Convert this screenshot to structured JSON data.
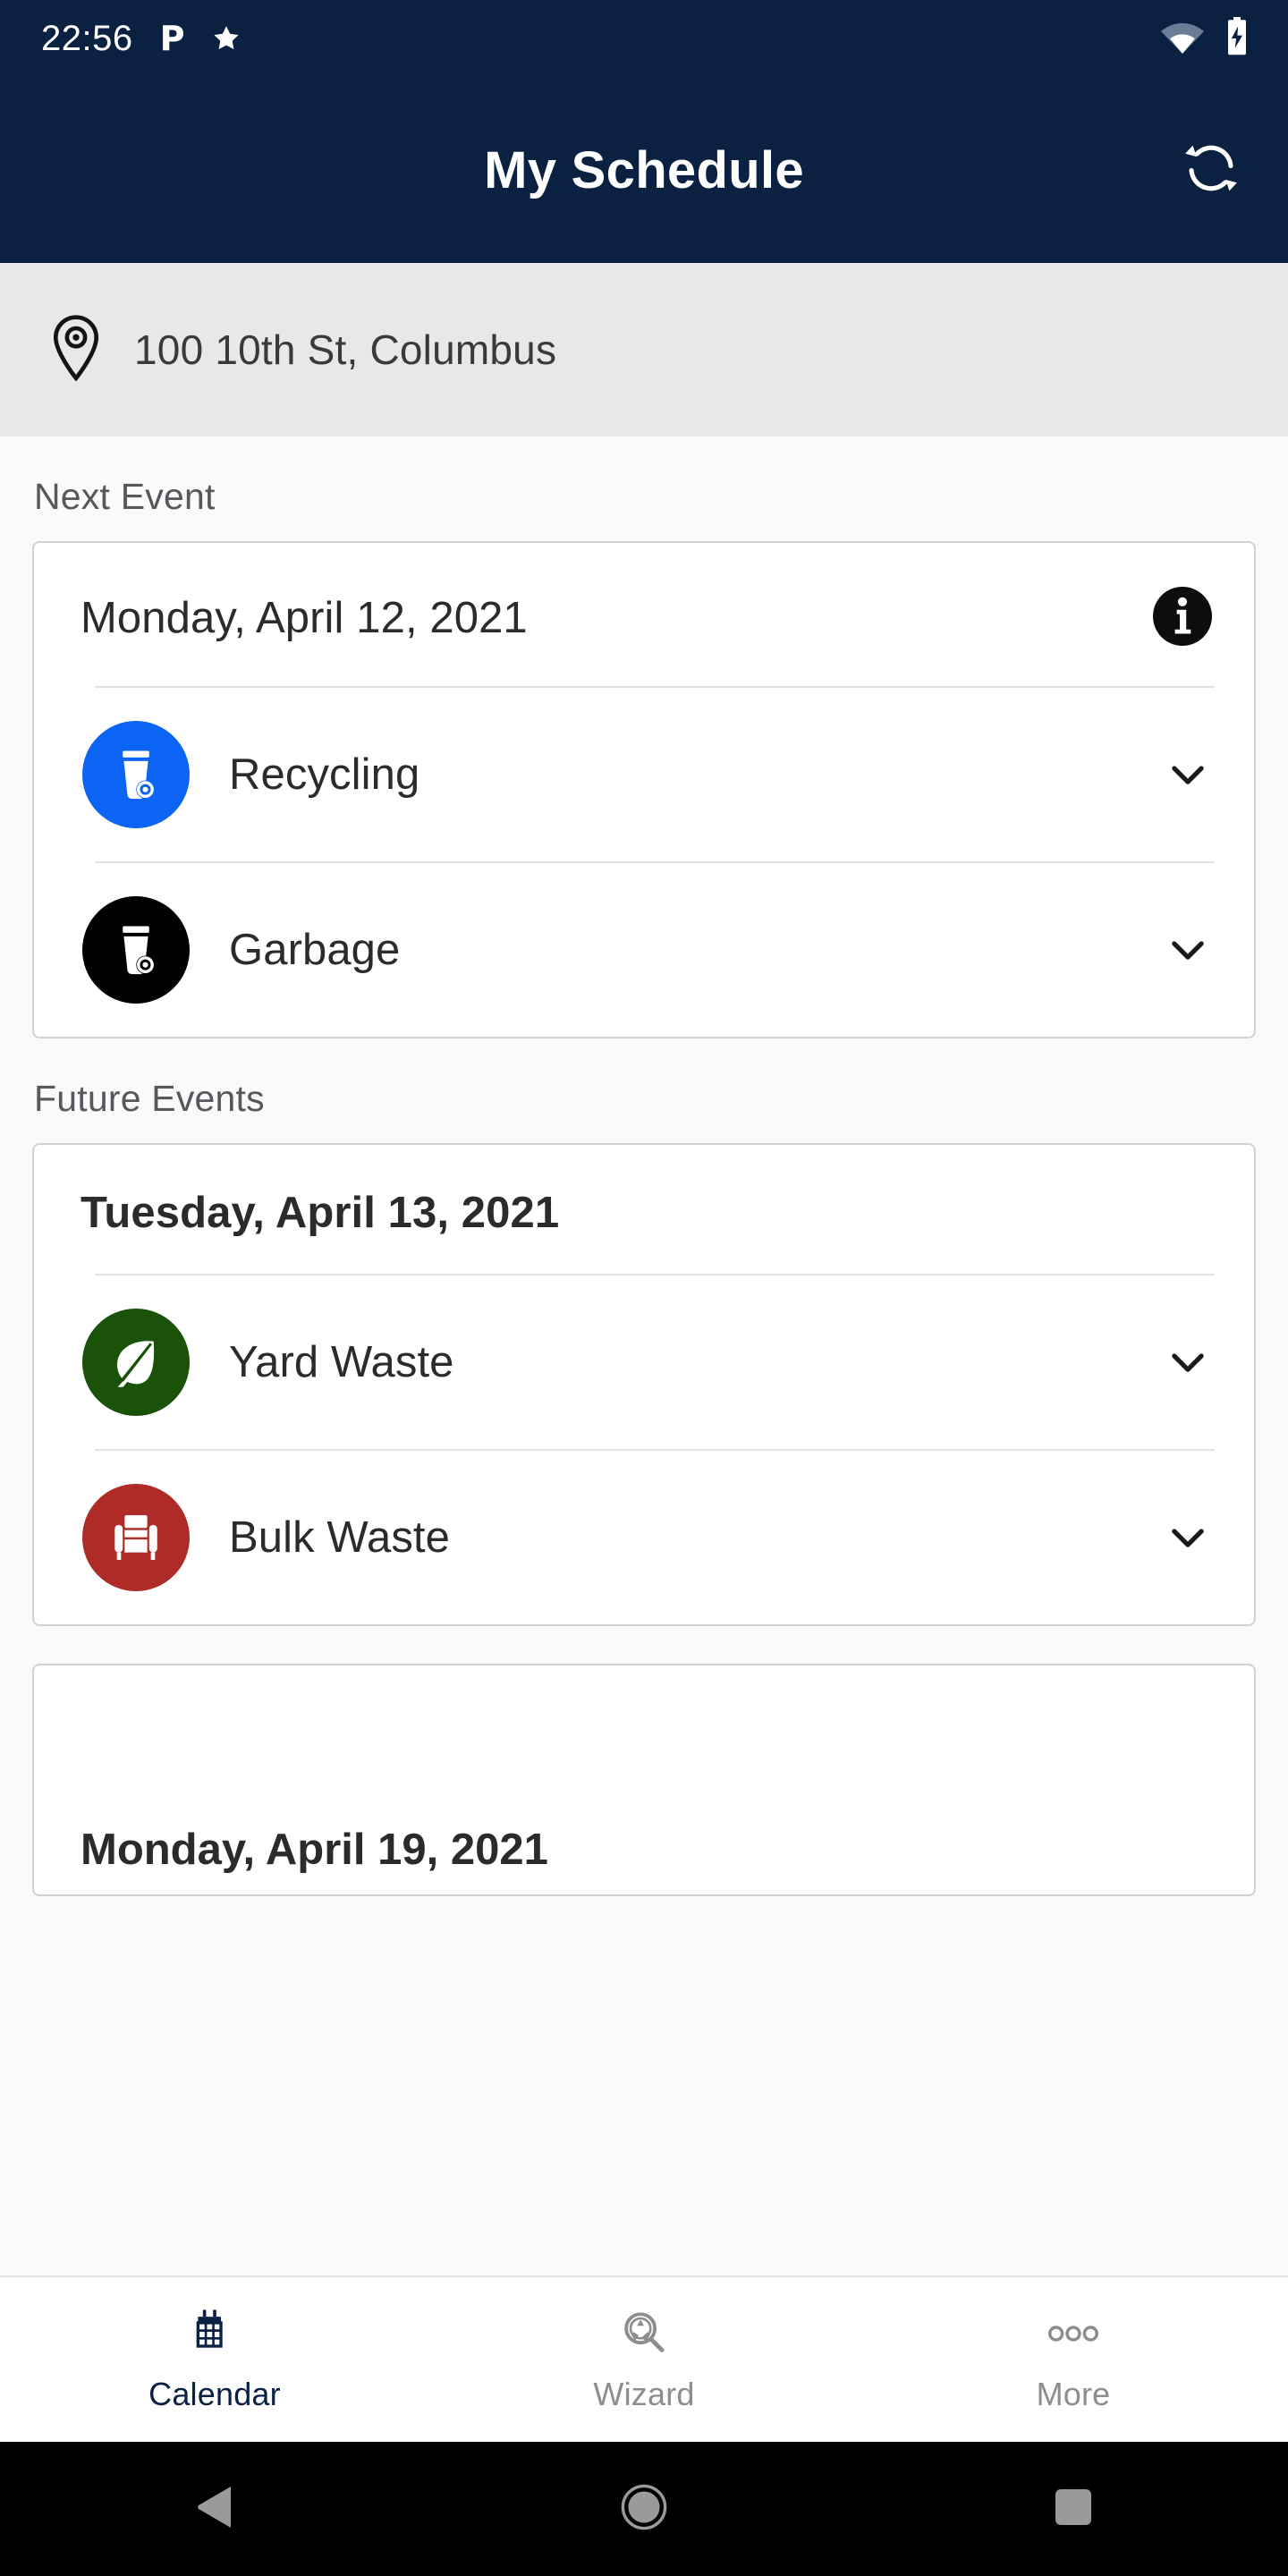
{
  "status_bar": {
    "time": "22:56",
    "left_icons": [
      "parking-p-icon",
      "star-icon"
    ],
    "right_icons": [
      "wifi-icon",
      "battery-charging-icon"
    ],
    "background_color": "#0b2142"
  },
  "app_bar": {
    "title": "My Schedule",
    "refresh_icon": "refresh-icon",
    "background_color": "#0b2142"
  },
  "address_bar": {
    "icon": "location-pin-icon",
    "address": "100 10th St, Columbus",
    "background_color": "#e8e8e8"
  },
  "sections": {
    "next_event_label": "Next Event",
    "future_events_label": "Future Events"
  },
  "next_event_card": {
    "date": "Monday, April 12, 2021",
    "info_icon": "info-circle-icon",
    "events": [
      {
        "name": "Recycling",
        "icon": "recycling-bin-icon",
        "color": "#0b64f4",
        "chevron": "chevron-down-icon"
      },
      {
        "name": "Garbage",
        "icon": "garbage-bin-icon",
        "color": "#000000",
        "chevron": "chevron-down-icon"
      }
    ]
  },
  "future_event_card": {
    "date": "Tuesday, April 13, 2021",
    "events": [
      {
        "name": "Yard Waste",
        "icon": "leaf-icon",
        "color": "#1a5209",
        "chevron": "chevron-down-icon"
      },
      {
        "name": "Bulk Waste",
        "icon": "armchair-icon",
        "color": "#ae2b28",
        "chevron": "chevron-down-icon"
      }
    ]
  },
  "peek_card": {
    "date": "Monday, April 19, 2021"
  },
  "bottom_nav": {
    "items": [
      {
        "label": "Calendar",
        "icon": "calendar-icon",
        "active": true,
        "color": "#0b2142"
      },
      {
        "label": "Wizard",
        "icon": "recycling-search-icon",
        "active": false,
        "color": "#8d8d8d"
      },
      {
        "label": "More",
        "icon": "more-dots-icon",
        "active": false,
        "color": "#8d8d8d"
      }
    ]
  },
  "system_nav": {
    "buttons": [
      "back-icon",
      "home-icon",
      "recents-icon"
    ],
    "background_color": "#000000"
  }
}
